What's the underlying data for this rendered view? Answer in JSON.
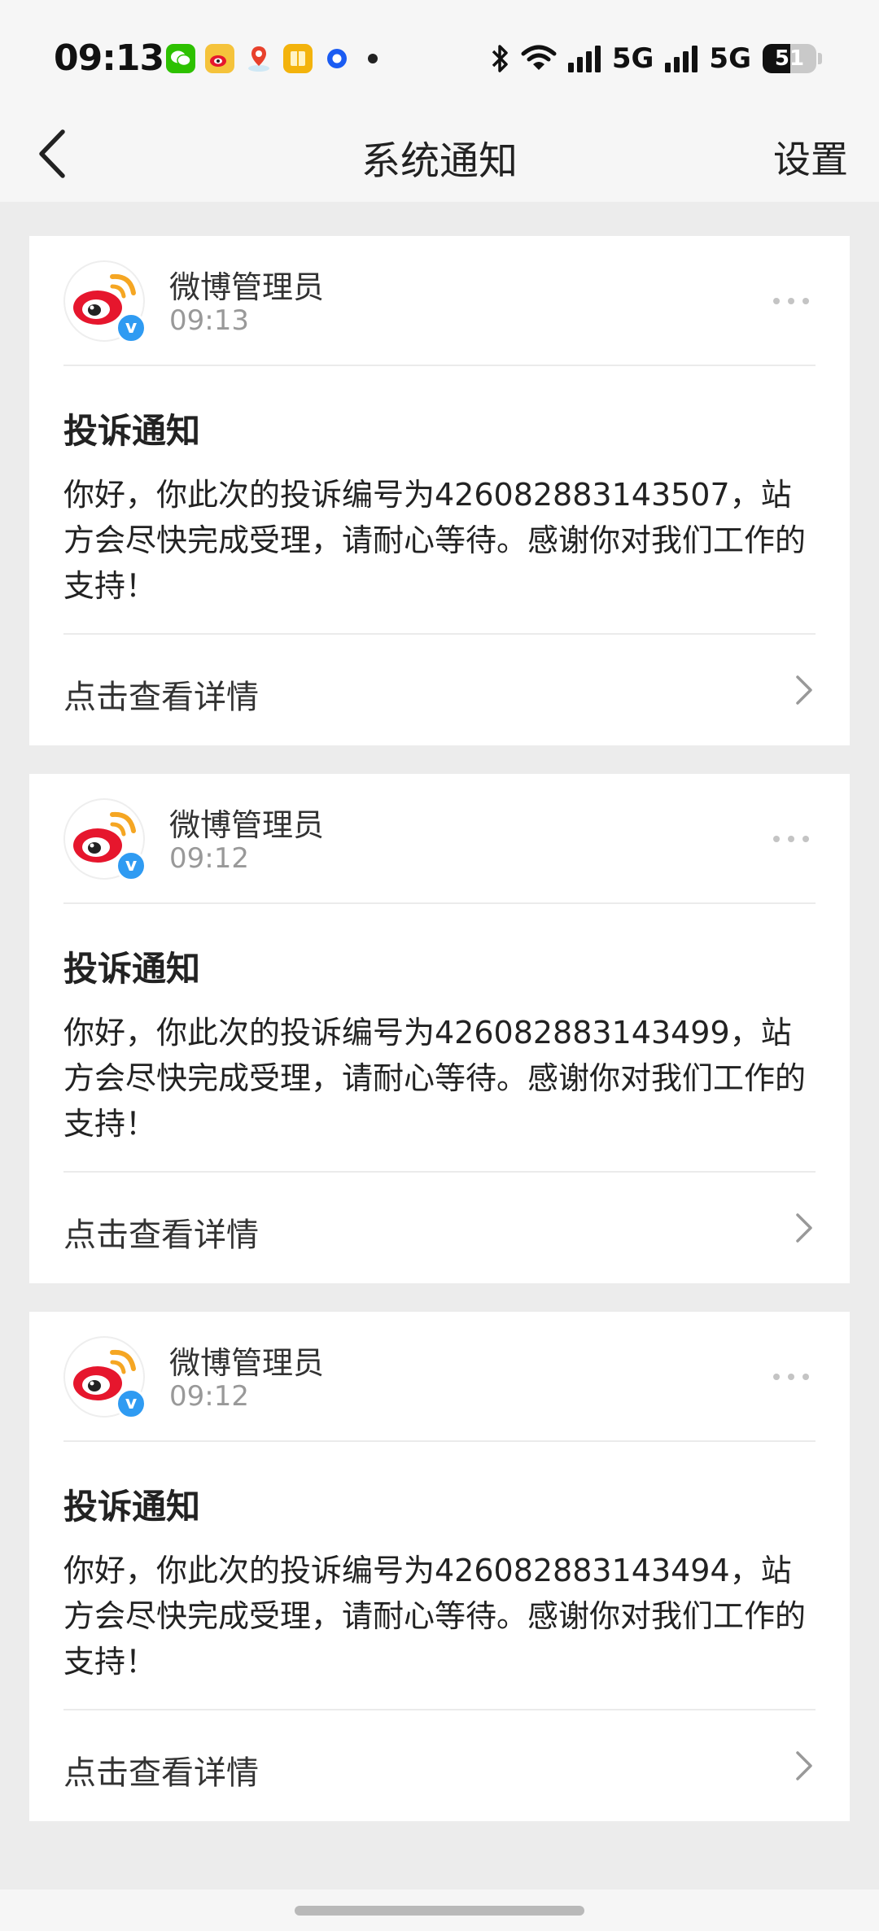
{
  "status_bar": {
    "time": "09:13",
    "network_1": "5G",
    "network_2": "5G",
    "battery": "51",
    "battery_level": 0.51,
    "notification_icons": [
      "wechat-icon",
      "weibo-icon",
      "map-pin-icon",
      "book-icon",
      "blue-app-icon",
      "more-notifications-dot"
    ]
  },
  "nav": {
    "title": "系统通知",
    "settings_label": "设置",
    "back_icon": "chevron-left-icon"
  },
  "messages": [
    {
      "sender": "微博管理员",
      "time": "09:13",
      "badge": "v",
      "title": "投诉通知",
      "body": "你好，你此次的投诉编号为426082883143507，站方会尽快完成受理，请耐心等待。感谢你对我们工作的支持！",
      "detail_label": "点击查看详情"
    },
    {
      "sender": "微博管理员",
      "time": "09:12",
      "badge": "v",
      "title": "投诉通知",
      "body": "你好，你此次的投诉编号为426082883143499，站方会尽快完成受理，请耐心等待。感谢你对我们工作的支持！",
      "detail_label": "点击查看详情"
    },
    {
      "sender": "微博管理员",
      "time": "09:12",
      "badge": "v",
      "title": "投诉通知",
      "body": "你好，你此次的投诉编号为426082883143494，站方会尽快完成受理，请耐心等待。感谢你对我们工作的支持！",
      "detail_label": "点击查看详情"
    }
  ],
  "colors": {
    "page_background": "#ececec",
    "bar_background": "#f6f6f6",
    "card_background": "#ffffff",
    "verified_blue": "#2f9bf2",
    "weibo_red": "#e6162d",
    "weibo_orange": "#f5a623"
  }
}
